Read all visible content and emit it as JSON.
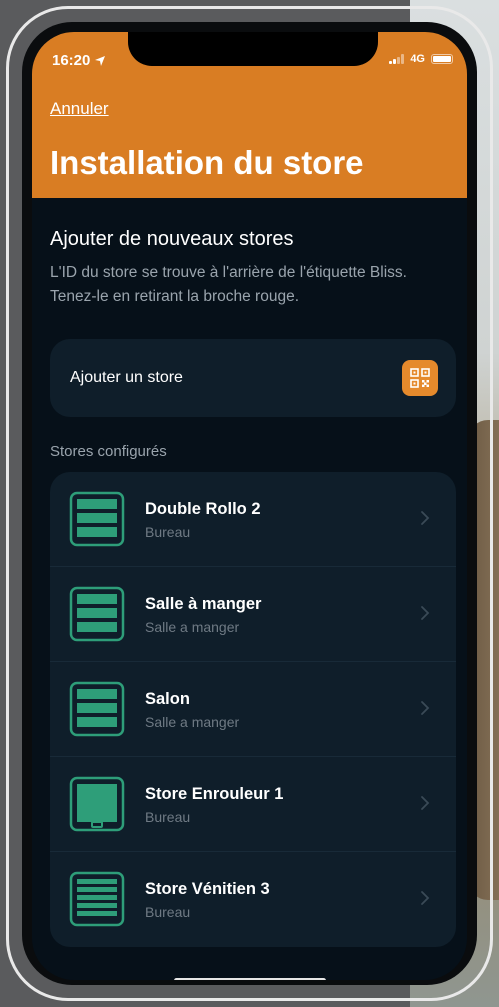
{
  "status_bar": {
    "time": "16:20",
    "network": "4G"
  },
  "header": {
    "cancel_label": "Annuler",
    "title": "Installation du store",
    "background": "#d97d23"
  },
  "add_section": {
    "title": "Ajouter de nouveaux stores",
    "description": "L'ID du store se trouve à l'arrière de l'étiquette Bliss. Tenez-le en retirant la broche rouge.",
    "add_button_label": "Ajouter un store",
    "qr_icon": "qr-code-icon"
  },
  "configured": {
    "header": "Stores configurés",
    "items": [
      {
        "name": "Double Rollo 2",
        "room": "Bureau",
        "icon": "double-roller-blind-icon"
      },
      {
        "name": "Salle à manger",
        "room": "Salle a manger",
        "icon": "double-roller-blind-icon"
      },
      {
        "name": "Salon",
        "room": "Salle a manger",
        "icon": "double-roller-blind-icon"
      },
      {
        "name": "Store Enrouleur 1",
        "room": "Bureau",
        "icon": "roller-blind-icon"
      },
      {
        "name": "Store Vénitien 3",
        "room": "Bureau",
        "icon": "venetian-blind-icon"
      }
    ]
  },
  "colors": {
    "accent": "#d97d23",
    "icon_green": "#2e9e79",
    "card": "#0f1e2a",
    "screen_bg": "#061019"
  }
}
